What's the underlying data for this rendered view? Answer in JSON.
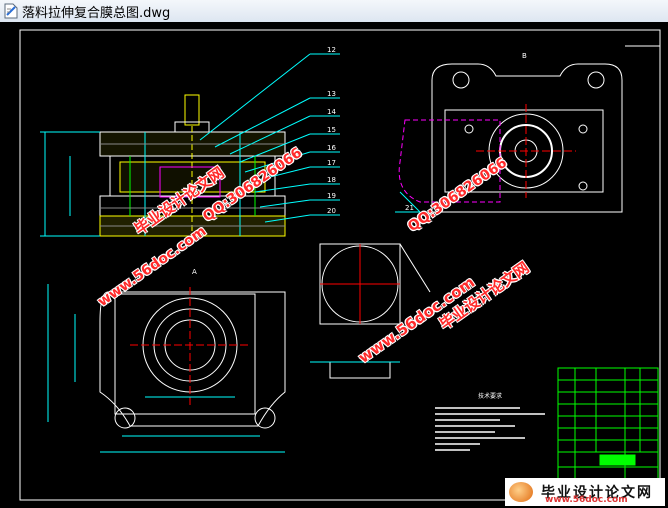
{
  "window": {
    "title": "落料拉伸复合膜总图.dwg"
  },
  "drawing": {
    "part_numbers": [
      "12",
      "13",
      "14",
      "15",
      "16",
      "17",
      "18",
      "19",
      "20",
      "21"
    ],
    "view_labels": {
      "top_view": "B",
      "bottom_view": "A"
    },
    "notes_title": "技术要求"
  },
  "watermarks": {
    "site_url": "www.56doc.com",
    "qq_text": "QQ:306826066",
    "site_name": "毕业设计论文网"
  },
  "logo": {
    "title": "毕业设计论文网",
    "url": "www.56doc.com"
  },
  "colors": {
    "cad_white": "#ffffff",
    "cad_yellow": "#ffff00",
    "cad_cyan": "#00ffff",
    "cad_green": "#00ff00",
    "cad_magenta": "#ff00ff",
    "watermark_red": "#ff2a2a"
  }
}
